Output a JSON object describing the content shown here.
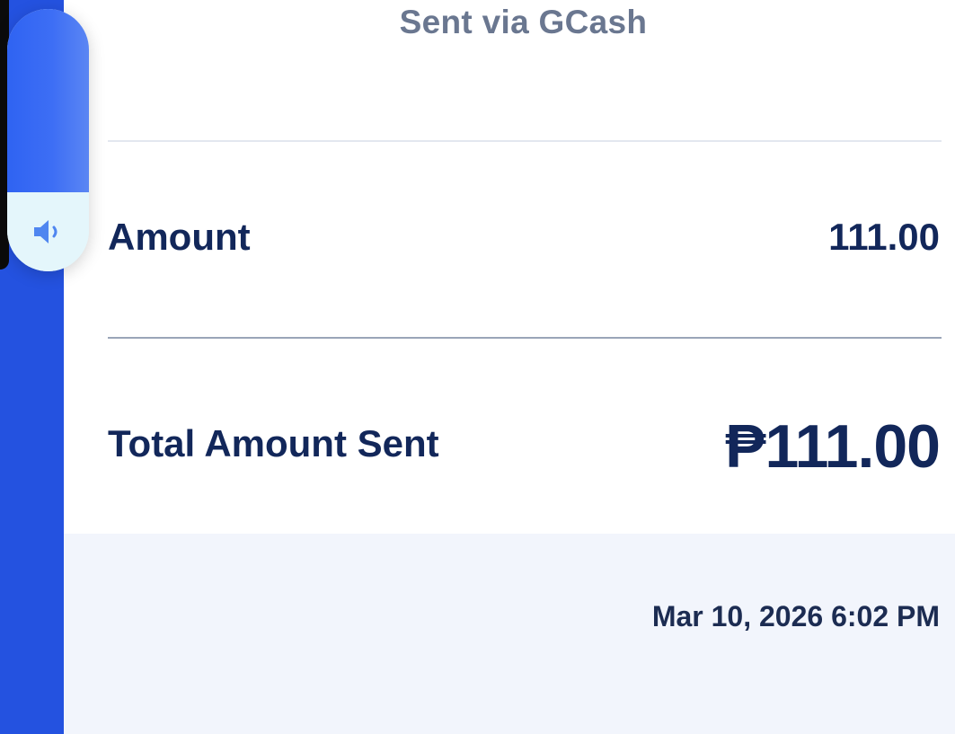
{
  "receipt": {
    "sent_via": "Sent via GCash",
    "amount_label": "Amount",
    "amount_value": "111.00",
    "total_label": "Total Amount Sent",
    "total_value": "₱111.00",
    "timestamp": "Mar 10, 2026 6:02 PM"
  },
  "volume_hud": {
    "icon": "speaker-icon",
    "level": 0.7
  },
  "colors": {
    "accent_blue": "#2452e0",
    "text_navy": "#12275a",
    "muted_text": "#6a7790",
    "footer_bg": "#f2f5fc"
  }
}
